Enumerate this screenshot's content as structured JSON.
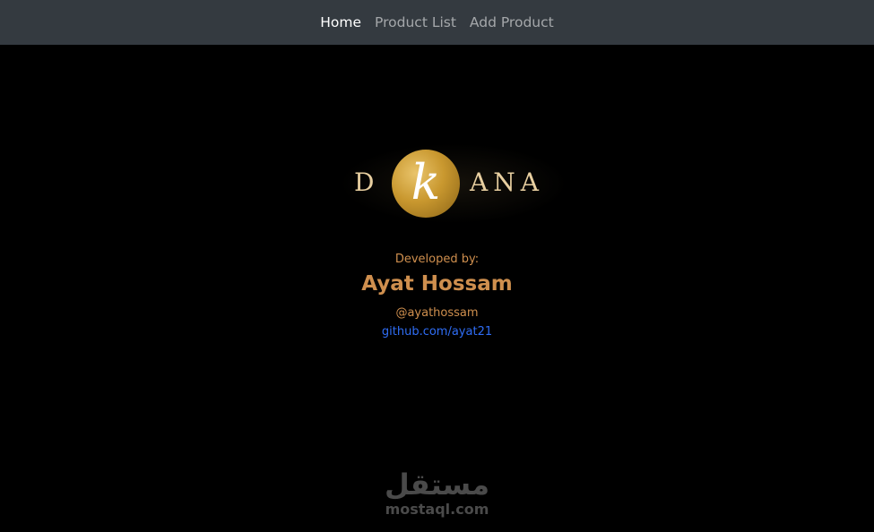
{
  "nav": {
    "items": [
      {
        "label": "Home",
        "active": true
      },
      {
        "label": "Product List",
        "active": false
      },
      {
        "label": "Add Product",
        "active": false
      }
    ]
  },
  "logo": {
    "letters_left": "D",
    "letter_circle": "k",
    "letters_right": "ANA",
    "colors": {
      "gold": "#c9982f",
      "text": "#e8cfa0"
    }
  },
  "credits": {
    "developed_by_label": "Developed by:",
    "name": "Ayat Hossam",
    "handle": "@ayathossam",
    "github": "github.com/ayat21"
  },
  "watermark": {
    "arabic": "مستقل",
    "latin": "mostaql.com"
  },
  "colors": {
    "navbar_bg": "#343a40",
    "page_bg": "#000000",
    "accent": "#cf8f4e",
    "link": "#2f6df5"
  }
}
